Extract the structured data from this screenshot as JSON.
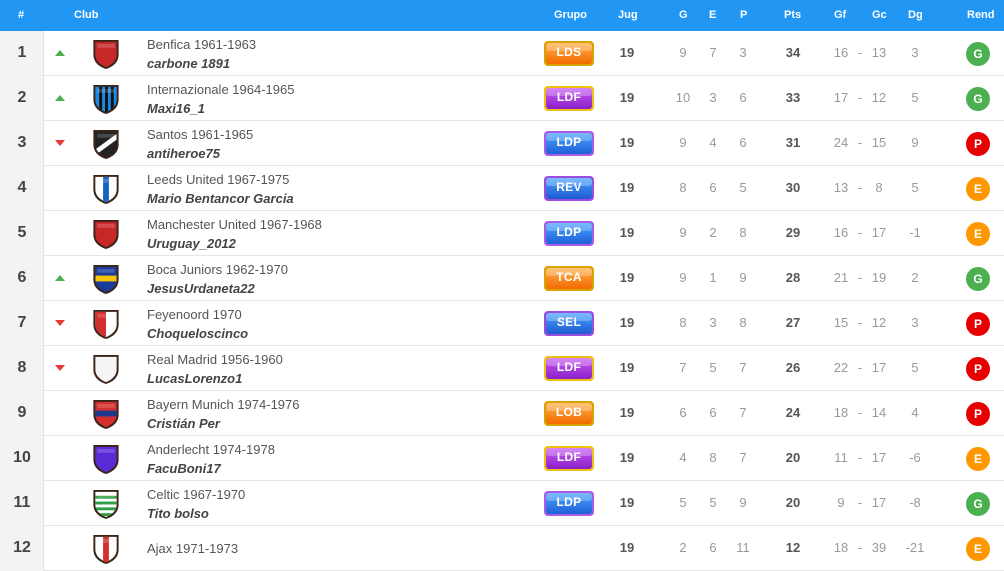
{
  "header": {
    "pos": "#",
    "club": "Club",
    "grupo": "Grupo",
    "jug": "Jug",
    "g": "G",
    "e": "E",
    "p": "P",
    "pts": "Pts",
    "gf": "Gf",
    "gc": "Gc",
    "dg": "Dg",
    "rend": "Rend"
  },
  "colors": {
    "header": "#2196f3",
    "up": "#4caf50",
    "down": "#e53935",
    "rend_G": "#4caf50",
    "rend_P": "#e60000",
    "rend_E": "#ff9800"
  },
  "rows": [
    {
      "pos": "1",
      "trend": "up",
      "crest": "shield-red",
      "club": "Benfica 1961-1963",
      "user": "carbone 1891",
      "grupo": "LDS",
      "grupo_color": "orange",
      "jug": "19",
      "g": "9",
      "e": "7",
      "p": "3",
      "pts": "34",
      "gf": "16",
      "sep": "-",
      "gc": "13",
      "dg": "3",
      "rend": "G"
    },
    {
      "pos": "2",
      "trend": "up",
      "crest": "shield-skyblue-stripes",
      "club": "Internazionale 1964-1965",
      "user": "Maxi16_1",
      "grupo": "LDF",
      "grupo_color": "purple",
      "jug": "19",
      "g": "10",
      "e": "3",
      "p": "6",
      "pts": "33",
      "gf": "17",
      "sep": "-",
      "gc": "12",
      "dg": "5",
      "rend": "G"
    },
    {
      "pos": "3",
      "trend": "down",
      "crest": "shield-black-white",
      "club": "Santos 1961-1965",
      "user": "antiheroe75",
      "grupo": "LDP",
      "grupo_color": "blue",
      "jug": "19",
      "g": "9",
      "e": "4",
      "p": "6",
      "pts": "31",
      "gf": "24",
      "sep": "-",
      "gc": "15",
      "dg": "9",
      "rend": "P"
    },
    {
      "pos": "4",
      "trend": "none",
      "crest": "shield-white-blue-yellow",
      "club": "Leeds United 1967-1975",
      "user": "Mario Bentancor Garcia",
      "grupo": "REV",
      "grupo_color": "blue-purple",
      "jug": "19",
      "g": "8",
      "e": "6",
      "p": "5",
      "pts": "30",
      "gf": "13",
      "sep": "-",
      "gc": "8",
      "dg": "5",
      "rend": "E"
    },
    {
      "pos": "5",
      "trend": "none",
      "crest": "shield-red",
      "club": "Manchester United 1967-1968",
      "user": "Uruguay_2012",
      "grupo": "LDP",
      "grupo_color": "blue",
      "jug": "19",
      "g": "9",
      "e": "2",
      "p": "8",
      "pts": "29",
      "gf": "16",
      "sep": "-",
      "gc": "17",
      "dg": "-1",
      "rend": "E"
    },
    {
      "pos": "6",
      "trend": "up",
      "crest": "shield-blue-yellow",
      "club": "Boca Juniors 1962-1970",
      "user": "JesusUrdaneta22",
      "grupo": "TCA",
      "grupo_color": "orange",
      "jug": "19",
      "g": "9",
      "e": "1",
      "p": "9",
      "pts": "28",
      "gf": "21",
      "sep": "-",
      "gc": "19",
      "dg": "2",
      "rend": "G"
    },
    {
      "pos": "7",
      "trend": "down",
      "crest": "shield-red-white",
      "club": "Feyenoord 1970",
      "user": "Choqueloscinco",
      "grupo": "SEL",
      "grupo_color": "blue-purple",
      "jug": "19",
      "g": "8",
      "e": "3",
      "p": "8",
      "pts": "27",
      "gf": "15",
      "sep": "-",
      "gc": "12",
      "dg": "3",
      "rend": "P"
    },
    {
      "pos": "8",
      "trend": "down",
      "crest": "shield-white",
      "club": "Real Madrid 1956-1960",
      "user": "LucasLorenzo1",
      "grupo": "LDF",
      "grupo_color": "purple",
      "jug": "19",
      "g": "7",
      "e": "5",
      "p": "7",
      "pts": "26",
      "gf": "22",
      "sep": "-",
      "gc": "17",
      "dg": "5",
      "rend": "P"
    },
    {
      "pos": "9",
      "trend": "none",
      "crest": "shield-red-blue",
      "club": "Bayern Munich 1974-1976",
      "user": "Cristián Per",
      "grupo": "LOB",
      "grupo_color": "orange",
      "jug": "19",
      "g": "6",
      "e": "6",
      "p": "7",
      "pts": "24",
      "gf": "18",
      "sep": "-",
      "gc": "14",
      "dg": "4",
      "rend": "P"
    },
    {
      "pos": "10",
      "trend": "none",
      "crest": "shield-purple",
      "club": "Anderlecht 1974-1978",
      "user": "FacuBoni17",
      "grupo": "LDF",
      "grupo_color": "purple",
      "jug": "19",
      "g": "4",
      "e": "8",
      "p": "7",
      "pts": "20",
      "gf": "11",
      "sep": "-",
      "gc": "17",
      "dg": "-6",
      "rend": "E"
    },
    {
      "pos": "11",
      "trend": "none",
      "crest": "shield-green-hoops",
      "club": "Celtic 1967-1970",
      "user": "Tito bolso",
      "grupo": "LDP",
      "grupo_color": "blue",
      "jug": "19",
      "g": "5",
      "e": "5",
      "p": "9",
      "pts": "20",
      "gf": "9",
      "sep": "-",
      "gc": "17",
      "dg": "-8",
      "rend": "G"
    },
    {
      "pos": "12",
      "trend": "none",
      "crest": "shield-white-red",
      "club": "Ajax 1971-1973",
      "user": "",
      "grupo": "",
      "grupo_color": "",
      "jug": "19",
      "g": "2",
      "e": "6",
      "p": "11",
      "pts": "12",
      "gf": "18",
      "sep": "-",
      "gc": "39",
      "dg": "-21",
      "rend": "E"
    }
  ]
}
